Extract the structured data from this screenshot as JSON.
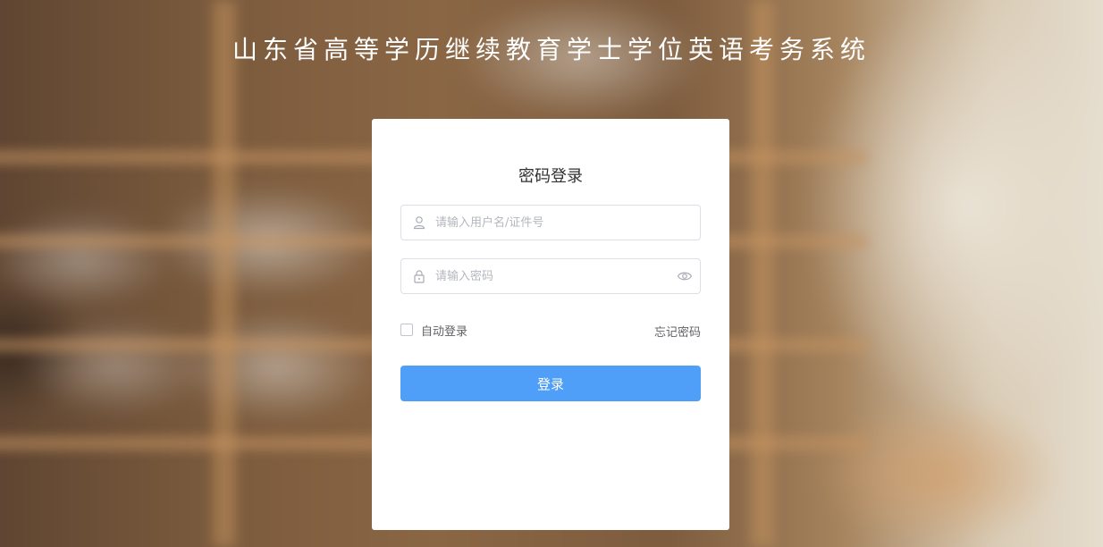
{
  "header": {
    "title": "山东省高等学历继续教育学士学位英语考务系统"
  },
  "login": {
    "title": "密码登录",
    "username_placeholder": "请输入用户名/证件号",
    "password_placeholder": "请输入密码",
    "remember_label": "自动登录",
    "forgot_label": "忘记密码",
    "submit_label": "登录"
  },
  "icons": {
    "username": "user-icon",
    "password": "lock-icon",
    "toggle_visibility": "eye-icon"
  },
  "colors": {
    "primary": "#4f9ef8",
    "title_text": "#ffffff",
    "card_bg": "#ffffff"
  }
}
